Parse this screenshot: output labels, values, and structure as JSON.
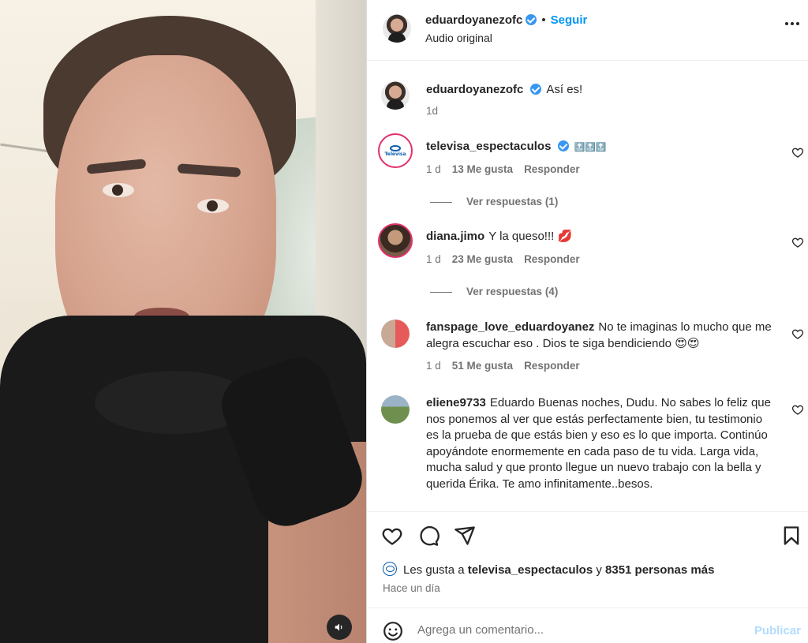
{
  "header": {
    "username": "eduardoyanezofc",
    "separator": "•",
    "follow_label": "Seguir",
    "audio_label": "Audio original"
  },
  "comments": [
    {
      "username": "eduardoyanezofc",
      "text": "Así es!",
      "verified": true,
      "time": "1d"
    },
    {
      "username": "televisa_espectaculos",
      "text": "🔝🔝🔝",
      "verified": true,
      "time": "1 d",
      "likes": "13 Me gusta",
      "reply_label": "Responder",
      "replies": "Ver respuestas (1)",
      "avatar_text": "Televisa"
    },
    {
      "username": "diana.jimo",
      "text": "Y la queso!!! 💋",
      "time": "1 d",
      "likes": "23 Me gusta",
      "reply_label": "Responder",
      "replies": "Ver respuestas (4)"
    },
    {
      "username": "fanspage_love_eduardoyanez",
      "text": "No te imaginas lo mucho que me alegra escuchar eso . Dios te siga bendiciendo 😍😍",
      "time": "1 d",
      "likes": "51 Me gusta",
      "reply_label": "Responder"
    },
    {
      "username": "eliene9733",
      "text": "Eduardo Buenas noches, Dudu. No sabes lo feliz que nos ponemos al ver que estás perfectamente bien, tu testimonio es la prueba de que estás bien y eso es lo que importa. Continúo apoyándote enormemente en cada paso de tu vida. Larga vida, mucha salud y que pronto llegue un nuevo trabajo con la bella y querida Érika. Te amo infinitamente..besos."
    }
  ],
  "likes": {
    "prefix": "Les gusta a",
    "user": "televisa_espectaculos",
    "conj": "y",
    "others": "8351 personas más"
  },
  "time_ago": "Hace un día",
  "composer": {
    "placeholder": "Agrega un comentario...",
    "publish_label": "Publicar"
  },
  "colors": {
    "accent": "#0095f6",
    "verified": "#3897f0",
    "secondary_text": "#737373",
    "publish_disabled": "#b3dbff"
  }
}
